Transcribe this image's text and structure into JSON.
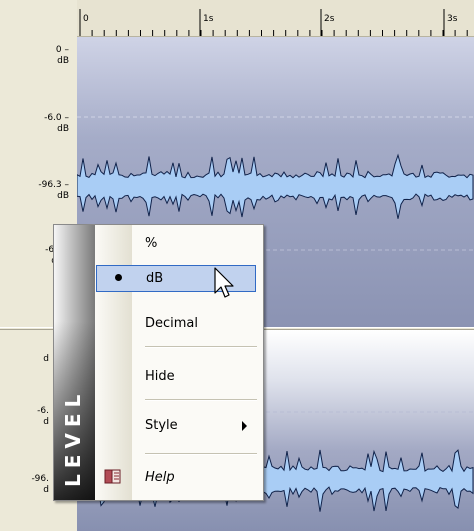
{
  "timeline": {
    "ticks": [
      "0",
      "1s",
      "2s",
      "3s"
    ]
  },
  "level_axis": {
    "top_track": [
      {
        "value": "0 –",
        "unit": "dB"
      },
      {
        "value": "-6.0 –",
        "unit": "dB"
      },
      {
        "value": "-96.3 –",
        "unit": "dB"
      },
      {
        "value": "-6.",
        "unit": "d"
      }
    ],
    "bottom_track": [
      {
        "value": "d",
        "unit": ""
      },
      {
        "value": "-6.",
        "unit": "d"
      },
      {
        "value": "-96.",
        "unit": "d"
      }
    ]
  },
  "context_menu": {
    "banner": "LEVEL",
    "items": [
      {
        "label": "%",
        "checked": false
      },
      {
        "label": "dB",
        "checked": true
      },
      {
        "label": "Decimal",
        "checked": false
      },
      {
        "label": "Hide",
        "checked": false
      },
      {
        "label": "Style",
        "checked": false,
        "submenu": true
      },
      {
        "label": "Help",
        "checked": false
      }
    ]
  },
  "colors": {
    "waveform_fill": "#a9cdf5",
    "waveform_stroke": "#10224a",
    "selection": "#c1d2ee",
    "selection_border": "#316ac5"
  },
  "icons": [
    "help-book-icon",
    "submenu-arrow-icon",
    "radio-bullet-icon",
    "mouse-pointer-icon"
  ]
}
